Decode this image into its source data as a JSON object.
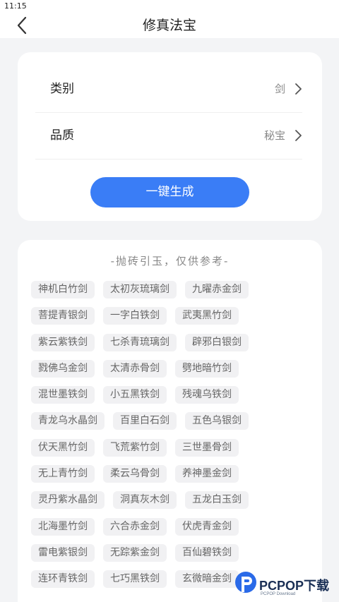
{
  "status_bar": {
    "time": "11:15"
  },
  "header": {
    "title": "修真法宝"
  },
  "form": {
    "rows": [
      {
        "label": "类别",
        "value": "剑"
      },
      {
        "label": "品质",
        "value": "秘宝"
      }
    ],
    "generate_label": "一键生成"
  },
  "results": {
    "hint": "-抛砖引玉，仅供参考-",
    "rows": [
      [
        "神机白竹剑",
        "太初灰琉璃剑",
        "九曜赤金剑"
      ],
      [
        "菩提青银剑",
        "一字白铁剑",
        "武夷黑竹剑"
      ],
      [
        "紫云紫铁剑",
        "七杀青琉璃剑",
        "辟邪白银剑"
      ],
      [
        "戮佛乌金剑",
        "太清赤骨剑",
        "劈地暗竹剑"
      ],
      [
        "混世墨铁剑",
        "小五黑铁剑",
        "残魂乌铁剑"
      ],
      [
        "青龙乌水晶剑",
        "百里白石剑",
        "五色乌银剑"
      ],
      [
        "伏天黑竹剑",
        "飞荒紫竹剑",
        "三世墨骨剑"
      ],
      [
        "无上青竹剑",
        "柔云乌骨剑",
        "养神墨金剑"
      ],
      [
        "灵丹紫水晶剑",
        "洞真灰木剑",
        "五龙白玉剑"
      ],
      [
        "北海墨竹剑",
        "六合赤金剑",
        "伏虎青金剑"
      ],
      [
        "雷电紫银剑",
        "无踪紫金剑",
        "百仙碧铁剑"
      ],
      [
        "连环青铁剑",
        "七巧黑铁剑",
        "玄微暗金剑"
      ]
    ]
  },
  "watermark": {
    "text": "PCPOP下载",
    "sub": "PCPOP Download"
  },
  "colors": {
    "accent": "#3a7df6",
    "background": "#f3f4f6",
    "tag_bg": "#f1f1f3"
  }
}
